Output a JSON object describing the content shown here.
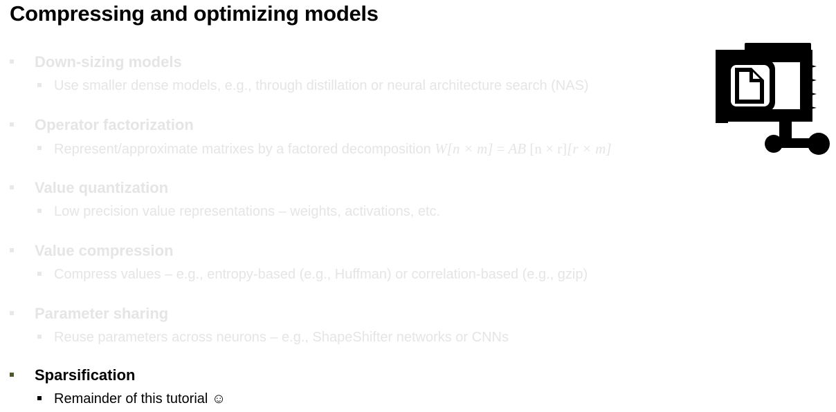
{
  "slide": {
    "title": "Compressing and optimizing models"
  },
  "items": [
    {
      "heading": "Down-sizing models",
      "detail": "Use smaller dense models, e.g., through distillation or neural architecture search (NAS)",
      "state": "faded"
    },
    {
      "heading": "Operator factorization",
      "detail": "Represent/approximate matrixes by a factored decomposition",
      "math": {
        "lhs": "W[n × m]",
        "eq": "=",
        "rhs": "AB",
        "dims1": "[n × r]",
        "dims2": "[r × m]"
      },
      "state": "faded"
    },
    {
      "heading": "Value quantization",
      "detail": "Low precision value representations – weights, activations, etc.",
      "state": "faded"
    },
    {
      "heading": "Value compression",
      "detail": "Compress values – e.g., entropy-based (e.g., Huffman) or correlation-based (e.g., gzip)",
      "state": "faded"
    },
    {
      "heading": "Parameter sharing",
      "detail": "Reuse parameters across neurons – e.g., ShapeShifter networks or CNNs",
      "state": "faded"
    },
    {
      "heading": "Sparsification",
      "detail": "Remainder of this tutorial ☺",
      "state": "active"
    }
  ],
  "icon": {
    "name": "file-compress-clamp-icon"
  },
  "colors": {
    "text": "#000000",
    "faded_text": "#e5e5e5",
    "active_bullet": "#4a5a2a"
  }
}
